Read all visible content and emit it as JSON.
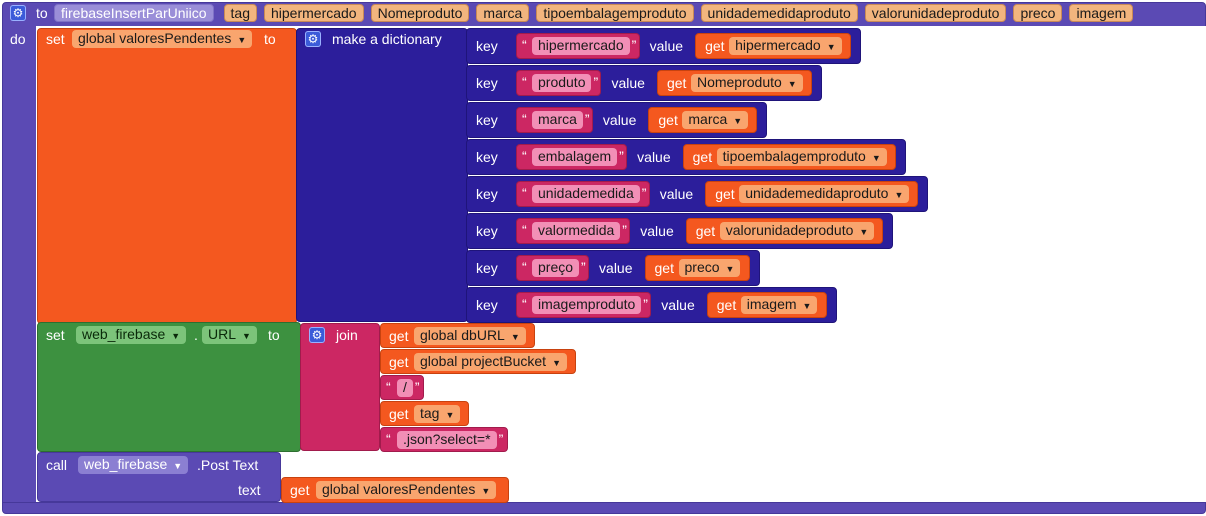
{
  "procedure": {
    "to_label": "to",
    "name": "firebaseInsertParUniico",
    "params": [
      "tag",
      "hipermercado",
      "Nomeproduto",
      "marca",
      "tipoembalagemproduto",
      "unidademedidaproduto",
      "valorunidadeproduto",
      "preco",
      "imagem"
    ],
    "do_label": "do"
  },
  "set_global": {
    "set_label": "set",
    "var": "global valoresPendentes",
    "to_label": "to"
  },
  "dictionary": {
    "title": "make a dictionary",
    "key_label": "key",
    "value_label": "value",
    "get_label": "get",
    "pairs": [
      {
        "key": "hipermercado",
        "value": "hipermercado"
      },
      {
        "key": "produto",
        "value": "Nomeproduto"
      },
      {
        "key": "marca",
        "value": "marca"
      },
      {
        "key": "embalagem",
        "value": "tipoembalagemproduto"
      },
      {
        "key": "unidademedida",
        "value": "unidademedidaproduto"
      },
      {
        "key": "valormedida",
        "value": "valorunidadeproduto"
      },
      {
        "key": "preço",
        "value": "preco"
      },
      {
        "key": "imagemproduto",
        "value": "imagem"
      }
    ]
  },
  "set_url": {
    "set_label": "set",
    "component": "web_firebase",
    "dot": ".",
    "property": "URL",
    "to_label": "to"
  },
  "join": {
    "title": "join",
    "get_label": "get",
    "items": [
      {
        "kind": "get",
        "text": "global dbURL"
      },
      {
        "kind": "get",
        "text": "global projectBucket"
      },
      {
        "kind": "text",
        "text": "/"
      },
      {
        "kind": "get",
        "text": "tag"
      },
      {
        "kind": "text",
        "text": ".json?select=*"
      }
    ]
  },
  "call": {
    "call_label": "call",
    "component": "web_firebase",
    "method": ".Post Text",
    "text_label": "text",
    "get_label": "get",
    "arg": "global valoresPendentes"
  },
  "colors": {
    "procedure": "#5b4ab4",
    "set_orange": "#f4581f",
    "dictionary": "#2c1e9b",
    "text_pink": "#cc2763",
    "component_green": "#3d9140"
  }
}
